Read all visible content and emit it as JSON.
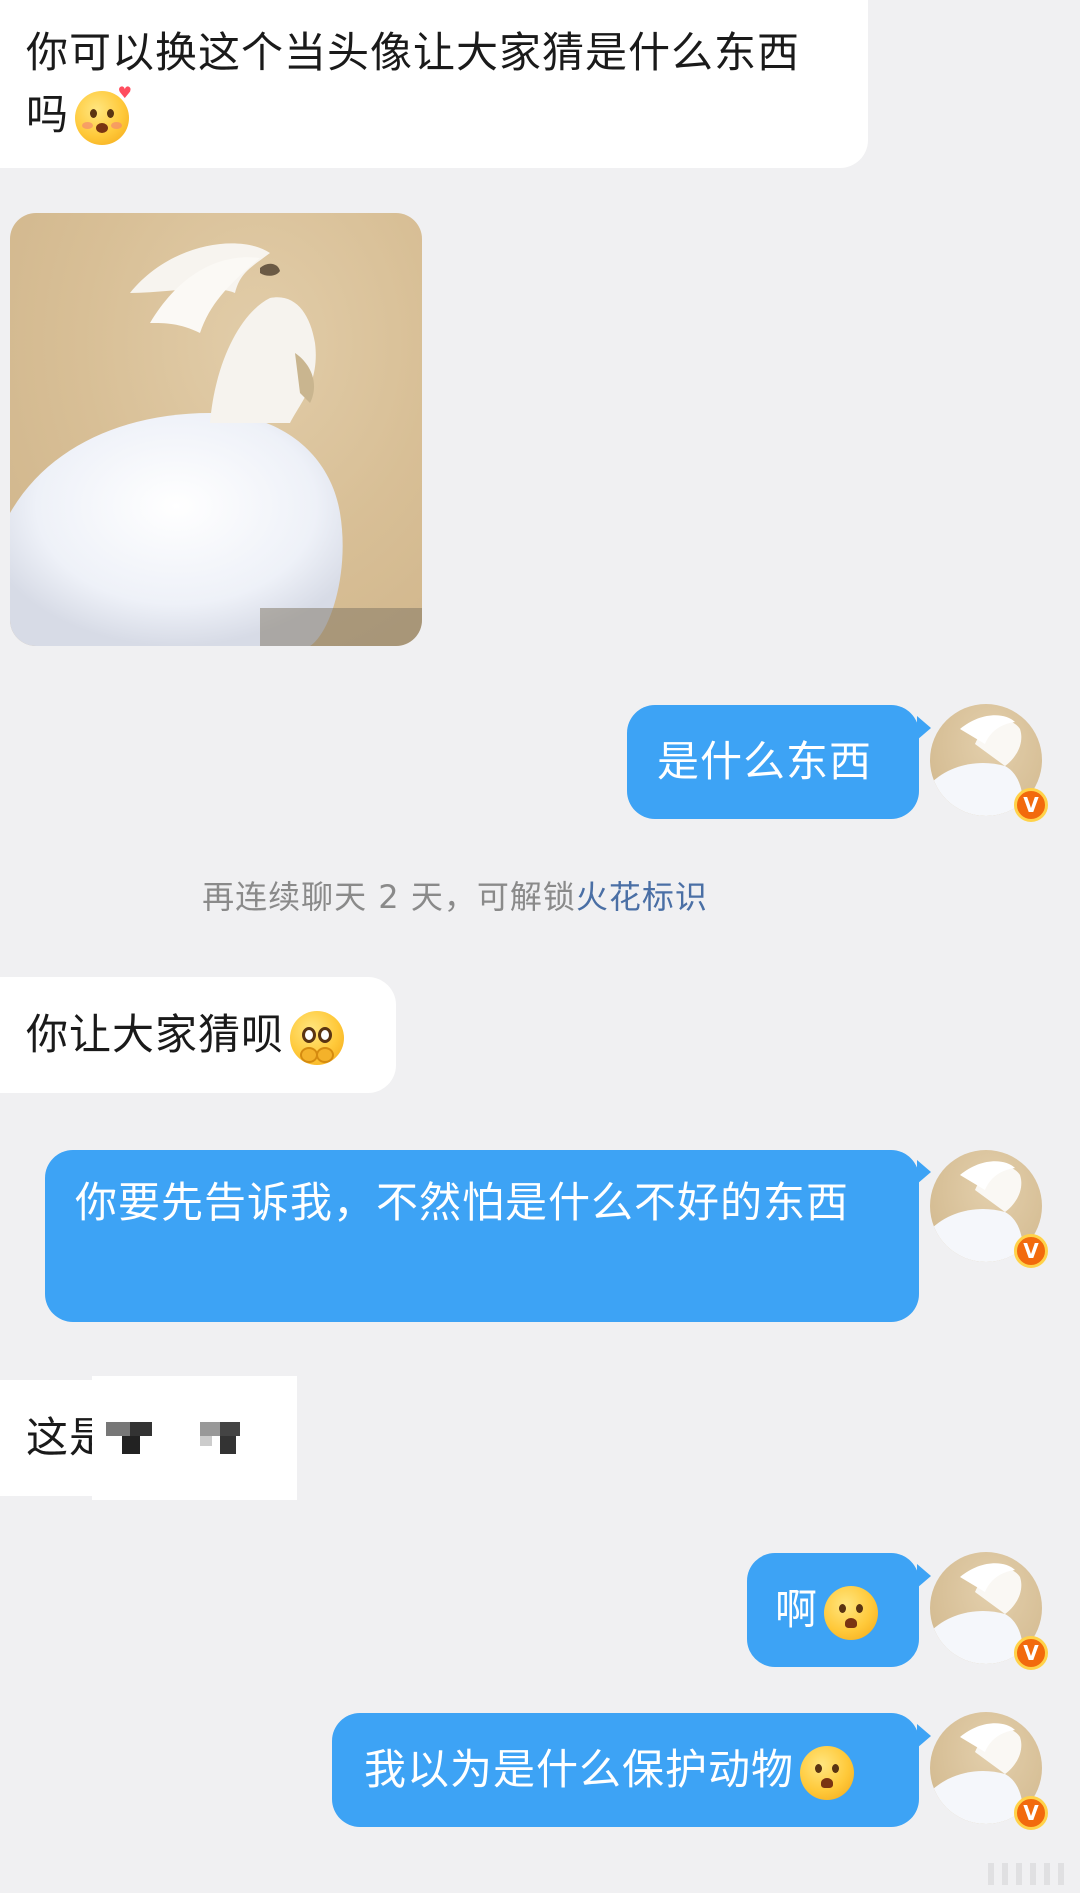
{
  "messages": [
    {
      "id": "m1",
      "side": "in",
      "text": "你可以换这个当头像让大家猜是什么东西吗"
    },
    {
      "id": "m2",
      "side": "in",
      "type": "image"
    },
    {
      "id": "m3",
      "side": "out",
      "text": "是什么东西"
    },
    {
      "id": "m4",
      "side": "in",
      "text": "你让大家猜呗"
    },
    {
      "id": "m5",
      "side": "out",
      "text": "你要先告诉我，不然怕是什么不好的东西"
    },
    {
      "id": "m6",
      "side": "in",
      "text": "这是"
    },
    {
      "id": "m7",
      "side": "out",
      "text": "啊"
    },
    {
      "id": "m8",
      "side": "out",
      "text": "我以为是什么保护动物"
    }
  ],
  "system_notice": {
    "prefix": "再连续聊天 2 天，可解锁",
    "link": "火花标识"
  },
  "avatar_badge": "V",
  "colors": {
    "background": "#f0f0f2",
    "incoming_bubble": "#ffffff",
    "outgoing_bubble": "#3da3f5",
    "link": "#4a6fa5",
    "badge": "#f26a0d"
  },
  "icons": [
    "emoji-blush-heart-icon",
    "emoji-pleading-icon",
    "emoji-frown-icon",
    "verified-badge-icon"
  ]
}
